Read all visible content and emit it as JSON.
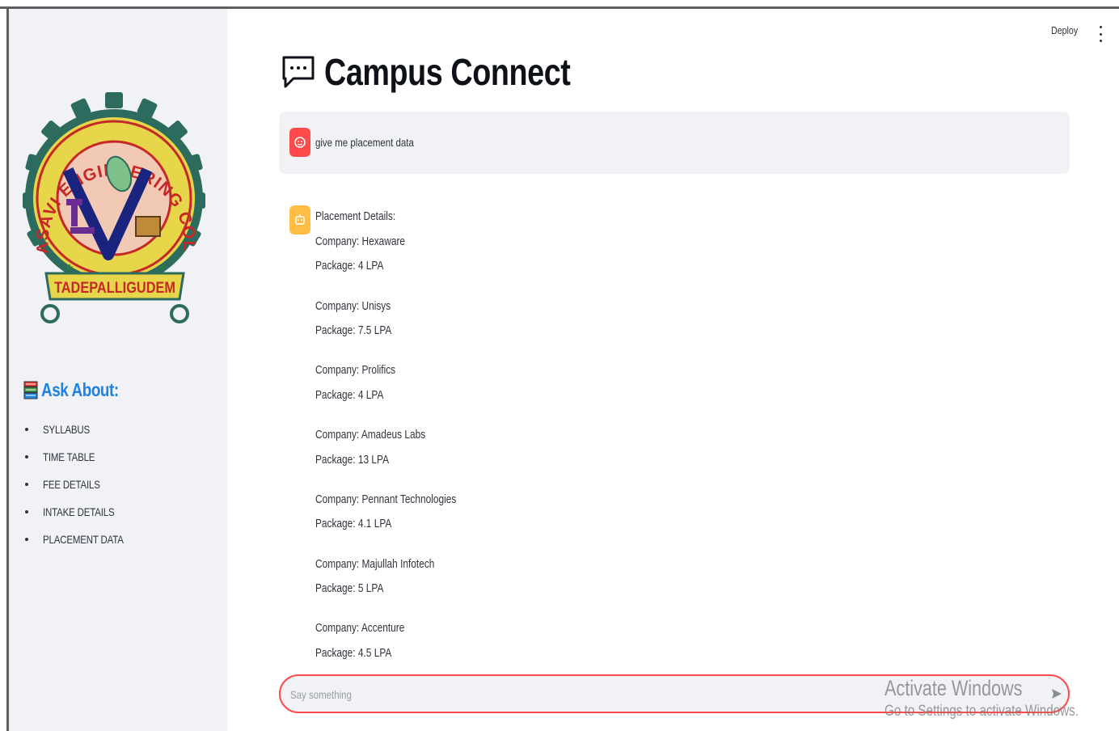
{
  "header": {
    "deploy_label": "Deploy",
    "menu_icon": "kebab-menu-icon"
  },
  "sidebar": {
    "logo": {
      "arc_text": "SRI VASAVI ENGINEERING COLLEGE",
      "banner_text": "TADEPALLIGUDEM"
    },
    "ask_title": "Ask About:",
    "ask_icon": "books-icon",
    "items": [
      {
        "label": "SYLLABUS"
      },
      {
        "label": "TIME TABLE"
      },
      {
        "label": "FEE DETAILS"
      },
      {
        "label": "INTAKE DETAILS"
      },
      {
        "label": "PLACEMENT DATA"
      }
    ]
  },
  "main": {
    "title": "Campus Connect",
    "title_icon": "speech-balloon-icon",
    "messages": {
      "user": {
        "text": "give me placement data"
      },
      "assistant": {
        "heading": "Placement Details:",
        "placements": [
          {
            "company": "Company: Hexaware",
            "package": "Package: 4 LPA"
          },
          {
            "company": "Company: Unisys",
            "package": "Package: 7.5 LPA"
          },
          {
            "company": "Company: Prolifics",
            "package": "Package: 4 LPA"
          },
          {
            "company": "Company: Amadeus Labs",
            "package": "Package: 13 LPA"
          },
          {
            "company": "Company: Pennant Technologies",
            "package": "Package: 4.1 LPA"
          },
          {
            "company": "Company: Majullah Infotech",
            "package": "Package: 5 LPA"
          },
          {
            "company": "Company: Accenture",
            "package": "Package: 4.5 LPA"
          }
        ]
      }
    },
    "chat_input": {
      "placeholder": "Say something",
      "value": ""
    }
  },
  "watermark": {
    "line1": "Activate Windows",
    "line2": "Go to Settings to activate Windows."
  },
  "colors": {
    "accent": "#ff4b4b",
    "sidebar_bg": "#f0f2f6",
    "link_blue": "#1c83e1",
    "bot_avatar": "#ffbd45"
  }
}
